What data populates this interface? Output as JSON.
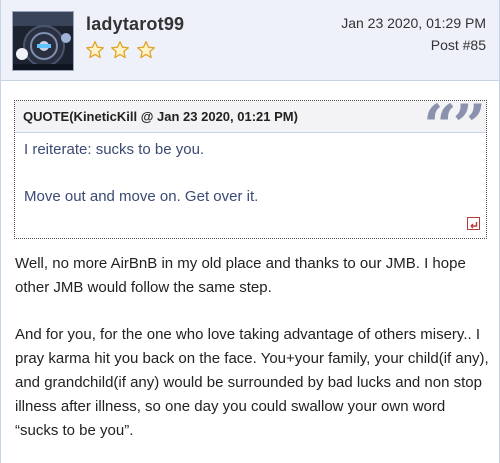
{
  "post": {
    "username": "ladytarot99",
    "rank_stars": 3,
    "date": "Jan 23 2020, 01:29 PM",
    "post_number": "Post #85",
    "avatar_icon": "car-dashboard-avatar"
  },
  "quote": {
    "title": "QUOTE(KineticKill @ Jan 23 2020, 01:21 PM)",
    "lines": [
      "I reiterate: sucks to be you.",
      "Move out and move on. Get over it."
    ],
    "marks": "66 99",
    "jump_icon": "jump-to-quoted-post-icon",
    "accent_color": "#8b92ad"
  },
  "message": {
    "paragraphs": [
      "Well, no more AirBnB in my old place and thanks to our JMB. I hope other JMB would follow the same step.",
      "And for you, for the one who love taking advantage of others misery.. I pray karma hit you back on the face. You+your family, your child(if any), and grandchild(if any) would be surrounded by bad lucks and non stop illness after illness, so one day you could swallow your own word “sucks to be you”."
    ]
  }
}
